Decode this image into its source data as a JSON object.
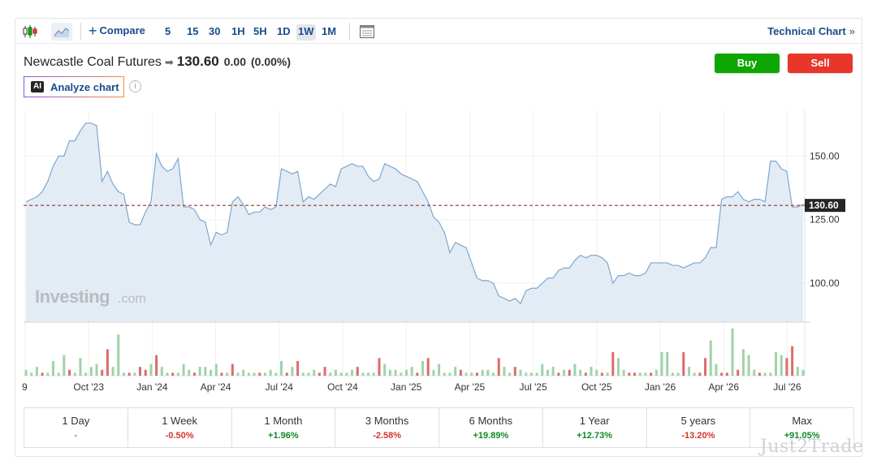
{
  "toolbar": {
    "compare_label": "Compare",
    "timeframes": [
      "5",
      "15",
      "30",
      "1H",
      "5H",
      "1D",
      "1W",
      "1M"
    ],
    "active_timeframe": "1W",
    "technical_label": "Technical Chart"
  },
  "header": {
    "name": "Newcastle Coal Futures",
    "price": "130.60",
    "change": "0.00",
    "change_pct": "(0.00%)",
    "buy_label": "Buy",
    "sell_label": "Sell",
    "analyze_label": "Analyze chart",
    "ai_badge": "AI",
    "info_icon": "i"
  },
  "watermark": {
    "brand": "Investing",
    "suffix": ".com",
    "corner": "Just2Trade"
  },
  "chart_data": {
    "type": "area",
    "ylim": [
      85,
      168
    ],
    "y_ticks": [
      100,
      125,
      150
    ],
    "y_tick_labels": [
      "100.00",
      "125.00",
      "150.00"
    ],
    "last_price": 130.6,
    "last_price_label": "130.60",
    "x_labels": [
      "9",
      "Oct '23",
      "Jan '24",
      "Apr '24",
      "Jul '24",
      "Oct '24",
      "Jan '25",
      "Apr '25",
      "Jul '25",
      "Oct '25",
      "Jan '26",
      "Apr '26",
      "Jul '26"
    ],
    "series": [
      {
        "values": [
          132,
          133,
          134,
          136,
          140,
          146,
          150,
          150,
          156,
          156,
          160,
          163,
          163,
          162,
          140,
          144,
          139,
          136,
          135,
          124,
          123,
          123,
          128,
          132,
          151,
          146,
          144,
          145,
          149,
          130,
          130,
          129,
          125,
          124,
          115,
          120,
          119,
          120,
          132,
          134,
          131,
          127,
          128,
          128,
          130,
          129,
          130,
          145,
          144,
          143,
          144,
          132,
          134,
          133,
          135,
          137,
          139,
          138,
          145,
          146,
          147,
          146,
          146,
          142,
          140,
          141,
          147,
          146,
          145,
          143,
          142,
          141,
          140,
          136,
          132,
          126,
          124,
          120,
          112,
          116,
          115,
          114,
          108,
          102,
          101,
          101,
          100,
          95,
          94,
          93,
          94,
          92,
          97,
          98,
          98,
          100,
          102,
          102,
          105,
          106,
          106,
          109,
          111,
          110,
          111,
          111,
          110,
          108,
          100,
          103,
          103,
          104,
          103,
          103,
          104,
          108,
          108,
          108,
          108,
          107,
          107,
          106,
          107,
          108,
          108,
          110,
          114,
          114,
          133,
          134,
          134,
          136,
          133,
          132,
          133,
          133,
          132,
          148,
          148,
          145,
          144,
          130,
          130,
          131
        ]
      }
    ],
    "volume": [
      [
        2,
        "up"
      ],
      [
        1,
        "up"
      ],
      [
        3,
        "up"
      ],
      [
        1,
        "dn"
      ],
      [
        1,
        "up"
      ],
      [
        5,
        "up"
      ],
      [
        1,
        "up"
      ],
      [
        7,
        "up"
      ],
      [
        2,
        "dn"
      ],
      [
        1,
        "up"
      ],
      [
        6,
        "up"
      ],
      [
        1,
        "up"
      ],
      [
        3,
        "up"
      ],
      [
        4,
        "up"
      ],
      [
        2,
        "dn"
      ],
      [
        9,
        "dn"
      ],
      [
        3,
        "up"
      ],
      [
        14,
        "up"
      ],
      [
        1,
        "up"
      ],
      [
        1,
        "dn"
      ],
      [
        1,
        "up"
      ],
      [
        3,
        "dn"
      ],
      [
        2,
        "dn"
      ],
      [
        4,
        "up"
      ],
      [
        7,
        "dn"
      ],
      [
        3,
        "up"
      ],
      [
        1,
        "up"
      ],
      [
        1,
        "dn"
      ],
      [
        1,
        "up"
      ],
      [
        4,
        "up"
      ],
      [
        2,
        "up"
      ],
      [
        1,
        "dn"
      ],
      [
        3,
        "up"
      ],
      [
        3,
        "up"
      ],
      [
        2,
        "up"
      ],
      [
        4,
        "up"
      ],
      [
        1,
        "dn"
      ],
      [
        1,
        "up"
      ],
      [
        4,
        "dn"
      ],
      [
        1,
        "up"
      ],
      [
        2,
        "up"
      ],
      [
        1,
        "up"
      ],
      [
        1,
        "up"
      ],
      [
        1,
        "dn"
      ],
      [
        1,
        "up"
      ],
      [
        2,
        "up"
      ],
      [
        1,
        "up"
      ],
      [
        5,
        "up"
      ],
      [
        1,
        "dn"
      ],
      [
        3,
        "up"
      ],
      [
        5,
        "dn"
      ],
      [
        1,
        "up"
      ],
      [
        1,
        "up"
      ],
      [
        2,
        "up"
      ],
      [
        1,
        "dn"
      ],
      [
        3,
        "dn"
      ],
      [
        1,
        "up"
      ],
      [
        2,
        "up"
      ],
      [
        1,
        "up"
      ],
      [
        1,
        "up"
      ],
      [
        2,
        "up"
      ],
      [
        3,
        "dn"
      ],
      [
        1,
        "up"
      ],
      [
        1,
        "up"
      ],
      [
        1,
        "up"
      ],
      [
        6,
        "dn"
      ],
      [
        4,
        "up"
      ],
      [
        2,
        "up"
      ],
      [
        2,
        "up"
      ],
      [
        1,
        "up"
      ],
      [
        2,
        "up"
      ],
      [
        3,
        "up"
      ],
      [
        1,
        "dn"
      ],
      [
        5,
        "up"
      ],
      [
        6,
        "dn"
      ],
      [
        2,
        "up"
      ],
      [
        4,
        "up"
      ],
      [
        1,
        "up"
      ],
      [
        1,
        "up"
      ],
      [
        3,
        "up"
      ],
      [
        2,
        "dn"
      ],
      [
        1,
        "up"
      ],
      [
        1,
        "up"
      ],
      [
        1,
        "dn"
      ],
      [
        2,
        "up"
      ],
      [
        2,
        "up"
      ],
      [
        1,
        "up"
      ],
      [
        6,
        "dn"
      ],
      [
        3,
        "up"
      ],
      [
        1,
        "up"
      ],
      [
        3,
        "dn"
      ],
      [
        2,
        "up"
      ],
      [
        1,
        "up"
      ],
      [
        1,
        "up"
      ],
      [
        1,
        "up"
      ],
      [
        4,
        "up"
      ],
      [
        2,
        "up"
      ],
      [
        3,
        "up"
      ],
      [
        1,
        "dn"
      ],
      [
        2,
        "up"
      ],
      [
        2,
        "dn"
      ],
      [
        4,
        "up"
      ],
      [
        2,
        "up"
      ],
      [
        1,
        "dn"
      ],
      [
        3,
        "up"
      ],
      [
        2,
        "up"
      ],
      [
        1,
        "dn"
      ],
      [
        1,
        "up"
      ],
      [
        8,
        "dn"
      ],
      [
        6,
        "up"
      ],
      [
        2,
        "up"
      ],
      [
        1,
        "dn"
      ],
      [
        1,
        "dn"
      ],
      [
        1,
        "up"
      ],
      [
        1,
        "up"
      ],
      [
        1,
        "dn"
      ],
      [
        2,
        "up"
      ],
      [
        8,
        "up"
      ],
      [
        8,
        "up"
      ],
      [
        1,
        "up"
      ],
      [
        1,
        "up"
      ],
      [
        8,
        "dn"
      ],
      [
        3,
        "up"
      ],
      [
        1,
        "up"
      ],
      [
        1,
        "dn"
      ],
      [
        6,
        "dn"
      ],
      [
        12,
        "up"
      ],
      [
        4,
        "up"
      ],
      [
        1,
        "dn"
      ],
      [
        1,
        "dn"
      ],
      [
        16,
        "up"
      ],
      [
        2,
        "dn"
      ],
      [
        9,
        "up"
      ],
      [
        7,
        "up"
      ],
      [
        2,
        "up"
      ],
      [
        1,
        "dn"
      ],
      [
        1,
        "up"
      ],
      [
        1,
        "up"
      ],
      [
        8,
        "up"
      ],
      [
        7,
        "up"
      ],
      [
        6,
        "dn"
      ],
      [
        10,
        "dn"
      ],
      [
        3,
        "up"
      ],
      [
        2,
        "up"
      ]
    ]
  },
  "performance": [
    {
      "label": "1 Day",
      "value": "-",
      "dir": "neu"
    },
    {
      "label": "1 Week",
      "value": "-0.50%",
      "dir": "neg"
    },
    {
      "label": "1 Month",
      "value": "+1.96%",
      "dir": "pos"
    },
    {
      "label": "3 Months",
      "value": "-2.58%",
      "dir": "neg"
    },
    {
      "label": "6 Months",
      "value": "+19.89%",
      "dir": "pos"
    },
    {
      "label": "1 Year",
      "value": "+12.73%",
      "dir": "pos"
    },
    {
      "label": "5 years",
      "value": "-13.20%",
      "dir": "neg"
    },
    {
      "label": "Max",
      "value": "+91.05%",
      "dir": "pos"
    }
  ],
  "colors": {
    "line": "#7ea7cc",
    "area": "#e3ecf5",
    "vol_up": "#9fd3a6",
    "vol_down": "#dd6b6b",
    "price_line": "#8b1a1a",
    "price_label_bg": "#232526",
    "accent": "#1a4b8c"
  }
}
